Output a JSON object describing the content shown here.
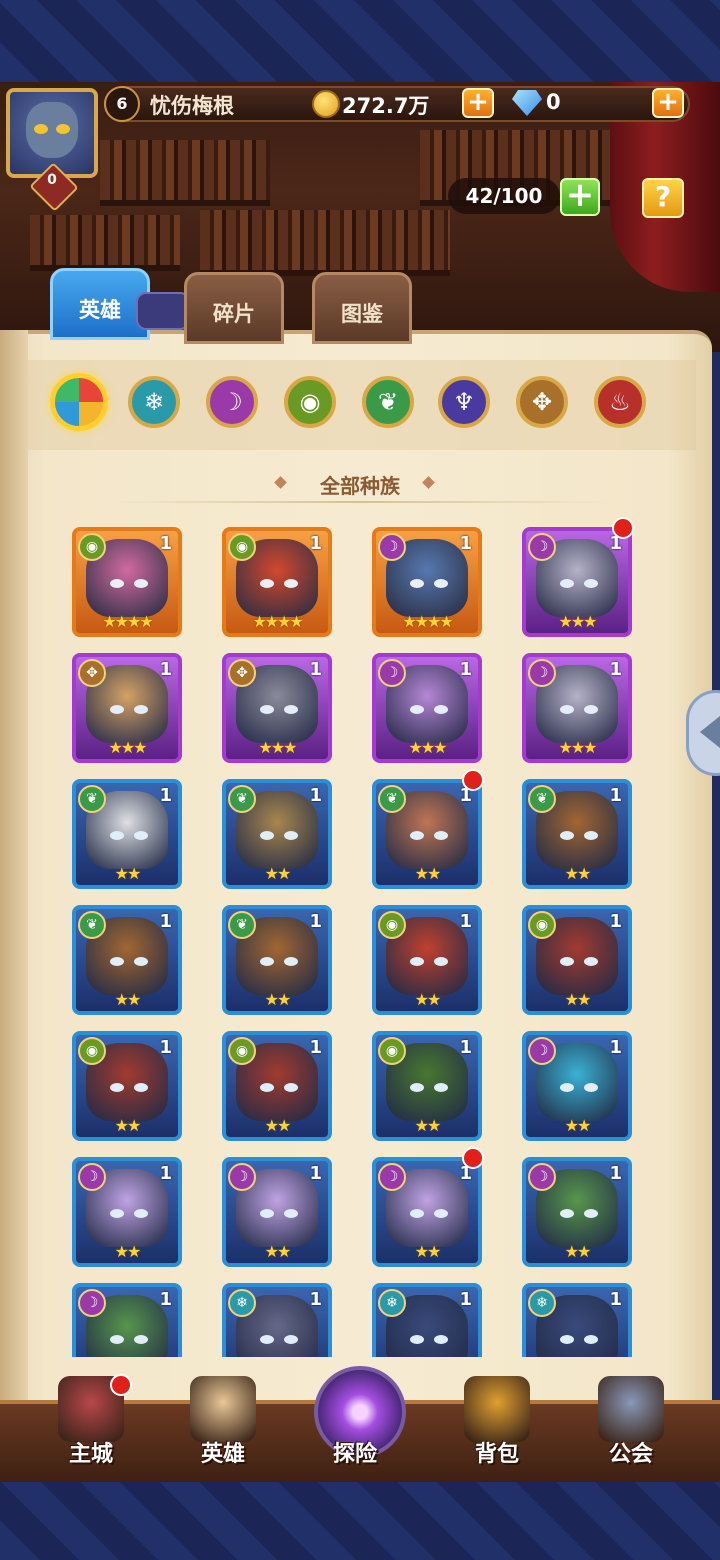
{
  "player": {
    "level": "6",
    "name": "忧伤梅根",
    "avatar_badge": "0"
  },
  "currency": {
    "gold": "272.7万",
    "gems": "0",
    "plus": "+"
  },
  "hero_capacity": {
    "text": "42/100",
    "add": "+",
    "help": "?"
  },
  "tabs": [
    {
      "label": "英雄",
      "active": true
    },
    {
      "label": "碎片",
      "active": false
    },
    {
      "label": "图鉴",
      "active": false
    }
  ],
  "race_filters": [
    {
      "icon": "all-races-icon",
      "color": "#e8443a",
      "selected": true
    },
    {
      "icon": "frost-race-icon",
      "color": "#2a9aa8"
    },
    {
      "icon": "dark-race-icon",
      "color": "#9a3aa8"
    },
    {
      "icon": "eye-race-icon",
      "color": "#6a9a24"
    },
    {
      "icon": "leaf-race-icon",
      "color": "#3a9a48"
    },
    {
      "icon": "demon-race-icon",
      "color": "#4a3aa0"
    },
    {
      "icon": "holy-race-icon",
      "color": "#a8702a"
    },
    {
      "icon": "fire-race-icon",
      "color": "#b8302a"
    }
  ],
  "section_title": "全部种族",
  "heroes": [
    {
      "level": "1",
      "stars": "★★★★",
      "frame": "orange",
      "race": "eye-race-icon",
      "tint": "#d06aa8"
    },
    {
      "level": "1",
      "stars": "★★★★",
      "frame": "orange",
      "race": "eye-race-icon",
      "tint": "#d2452e"
    },
    {
      "level": "1",
      "stars": "★★★★",
      "frame": "orange",
      "race": "dark-race-icon",
      "tint": "#4f78b8"
    },
    {
      "level": "1",
      "stars": "★★★",
      "frame": "purple",
      "race": "dark-race-icon",
      "tint": "#b8b8c8",
      "dot": true
    },
    {
      "level": "1",
      "stars": "★★★",
      "frame": "purple",
      "race": "holy-race-icon",
      "tint": "#d8a860"
    },
    {
      "level": "1",
      "stars": "★★★",
      "frame": "purple",
      "race": "holy-race-icon",
      "tint": "#8a8e98"
    },
    {
      "level": "1",
      "stars": "★★★",
      "frame": "purple",
      "race": "dark-race-icon",
      "tint": "#b88ad8"
    },
    {
      "level": "1",
      "stars": "★★★",
      "frame": "purple",
      "race": "dark-race-icon",
      "tint": "#b8b8c8"
    },
    {
      "level": "1",
      "stars": "★★",
      "frame": "blue",
      "race": "leaf-race-icon",
      "tint": "#e8e8e8"
    },
    {
      "level": "1",
      "stars": "★★",
      "frame": "blue",
      "race": "leaf-race-icon",
      "tint": "#b08a4a"
    },
    {
      "level": "1",
      "stars": "★★",
      "frame": "blue",
      "race": "leaf-race-icon",
      "tint": "#c87850",
      "dot": true
    },
    {
      "level": "1",
      "stars": "★★",
      "frame": "blue",
      "race": "leaf-race-icon",
      "tint": "#a8682c"
    },
    {
      "level": "1",
      "stars": "★★",
      "frame": "blue",
      "race": "leaf-race-icon",
      "tint": "#a8682c"
    },
    {
      "level": "1",
      "stars": "★★",
      "frame": "blue",
      "race": "leaf-race-icon",
      "tint": "#a8682c"
    },
    {
      "level": "1",
      "stars": "★★",
      "frame": "blue",
      "race": "eye-race-icon",
      "tint": "#c84028"
    },
    {
      "level": "1",
      "stars": "★★",
      "frame": "blue",
      "race": "eye-race-icon",
      "tint": "#a83a2a"
    },
    {
      "level": "1",
      "stars": "★★",
      "frame": "blue",
      "race": "eye-race-icon",
      "tint": "#a83a2a"
    },
    {
      "level": "1",
      "stars": "★★",
      "frame": "blue",
      "race": "eye-race-icon",
      "tint": "#a83a2a"
    },
    {
      "level": "1",
      "stars": "★★",
      "frame": "blue",
      "race": "eye-race-icon",
      "tint": "#4a7a2a"
    },
    {
      "level": "1",
      "stars": "★★",
      "frame": "blue",
      "race": "dark-race-icon",
      "tint": "#3ab8d8"
    },
    {
      "level": "1",
      "stars": "★★",
      "frame": "blue",
      "race": "dark-race-icon",
      "tint": "#c8a8e8"
    },
    {
      "level": "1",
      "stars": "★★",
      "frame": "blue",
      "race": "dark-race-icon",
      "tint": "#c8a8e8"
    },
    {
      "level": "1",
      "stars": "★★",
      "frame": "blue",
      "race": "dark-race-icon",
      "tint": "#c8a8e8",
      "dot": true
    },
    {
      "level": "1",
      "stars": "★★",
      "frame": "blue",
      "race": "dark-race-icon",
      "tint": "#5a9a48"
    },
    {
      "level": "1",
      "stars": "",
      "frame": "blue",
      "race": "dark-race-icon",
      "tint": "#5a9a48"
    },
    {
      "level": "1",
      "stars": "",
      "frame": "blue",
      "race": "frost-race-icon",
      "tint": "#6a6a88"
    },
    {
      "level": "1",
      "stars": "",
      "frame": "blue",
      "race": "frost-race-icon",
      "tint": "#3a4a7a"
    },
    {
      "level": "1",
      "stars": "",
      "frame": "blue",
      "race": "frost-race-icon",
      "tint": "#3a4a7a"
    }
  ],
  "bottom_nav": [
    {
      "label": "主城",
      "icon": "castle-icon",
      "dot": true,
      "color": "#b8474a"
    },
    {
      "label": "英雄",
      "icon": "hero-portrait-icon",
      "color": "#e8c898"
    },
    {
      "label": "探险",
      "icon": "portal-icon",
      "center": true
    },
    {
      "label": "背包",
      "icon": "backpack-icon",
      "color": "#e0a030"
    },
    {
      "label": "公会",
      "icon": "guild-tower-icon",
      "color": "#8a98b8"
    }
  ]
}
